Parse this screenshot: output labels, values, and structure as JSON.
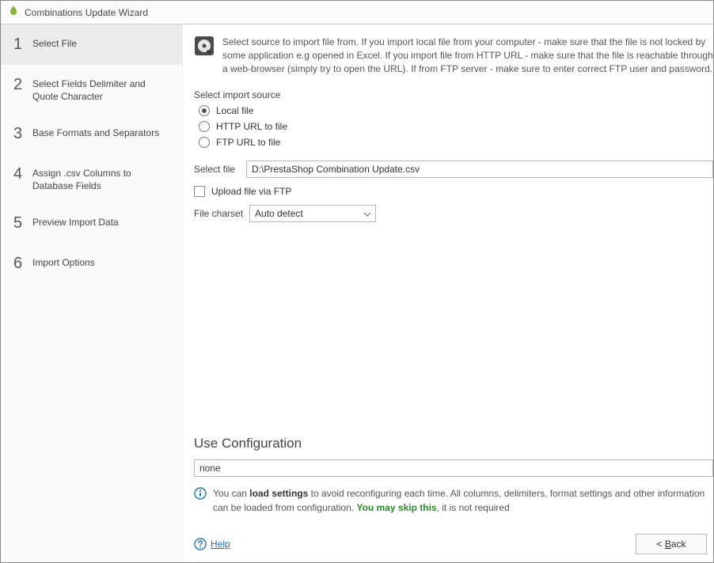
{
  "window": {
    "title": "Combinations Update Wizard"
  },
  "sidebar": {
    "steps": [
      {
        "num": "1",
        "label": "Select File",
        "active": true
      },
      {
        "num": "2",
        "label": "Select Fields Delimiter and Quote Character",
        "active": false
      },
      {
        "num": "3",
        "label": "Base Formats and Separators",
        "active": false
      },
      {
        "num": "4",
        "label": "Assign .csv Columns to Database Fields",
        "active": false
      },
      {
        "num": "5",
        "label": "Preview Import Data",
        "active": false
      },
      {
        "num": "6",
        "label": "Import Options",
        "active": false
      }
    ]
  },
  "info": {
    "text": "Select source to import file from. If you import local file from your computer - make sure that the file is not locked by some application e.g opened in Excel. If you import file from HTTP URL - make sure that the file is reachable through a web-browser (simply try to open the URL). If from FTP server - make sure to enter correct FTP user and password."
  },
  "source": {
    "label": "Select import source",
    "options": [
      {
        "label": "Local file",
        "selected": true
      },
      {
        "label": "HTTP URL to file",
        "selected": false
      },
      {
        "label": "FTP URL to file",
        "selected": false
      }
    ]
  },
  "file": {
    "label": "Select file",
    "value": "D:\\PrestaShop Combination Update.csv"
  },
  "upload_ftp": {
    "label": "Upload file via FTP",
    "checked": false
  },
  "charset": {
    "label": "File charset",
    "value": "Auto detect"
  },
  "config": {
    "title": "Use Configuration",
    "value": "none",
    "hint_prefix": "You can ",
    "hint_bold": "load settings",
    "hint_mid": " to avoid reconfiguring each time. All columns, delimiters, format settings and other information can be loaded from configuration. ",
    "hint_green": "You may skip this",
    "hint_suffix": ", it is not required"
  },
  "footer": {
    "help": "Help",
    "back_prefix": "< ",
    "back_letter": "B",
    "back_suffix": "ack"
  }
}
